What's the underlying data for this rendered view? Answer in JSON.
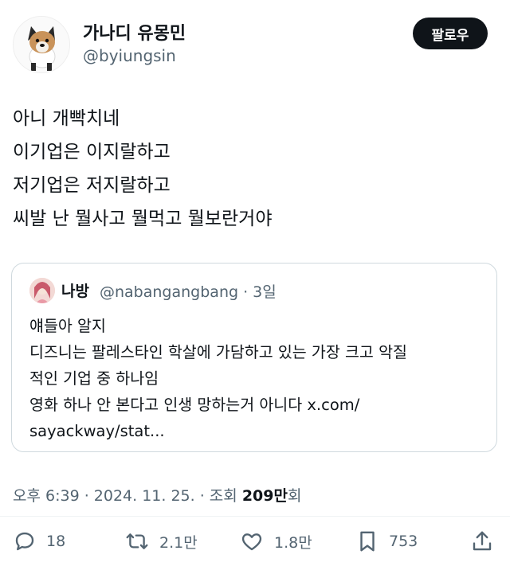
{
  "author": {
    "display_name": "가나디 유몽민",
    "handle": "@byiungsin",
    "follow_label": "팔로우"
  },
  "tweet": {
    "lines": [
      "아니 개빡치네",
      "이기업은 이지랄하고",
      "저기업은 저지랄하고",
      "씨발 난 뭘사고 뭘먹고 뭘보란거야"
    ]
  },
  "quote": {
    "name": "나방",
    "handle": "@nabangangbang",
    "time": "3일",
    "meta": "@nabangangbang · 3일",
    "lines": [
      "얘들아 알지",
      "디즈니는 팔레스타인 학살에 가담하고 있는 가장 크고 악질",
      "적인 기업 중 하나임",
      "영화 하나 안 본다고 인생 망하는거 아니다 x.com/",
      "sayackway/stat..."
    ]
  },
  "meta": {
    "prefix": "오후 6:39 · 2024. 11. 25. · 조회 ",
    "views": "209만",
    "suffix": "회"
  },
  "actions": {
    "replies": "18",
    "retweets": "2.1만",
    "likes": "1.8만",
    "bookmarks": "753"
  },
  "icons": [
    "reply-icon",
    "retweet-icon",
    "like-icon",
    "bookmark-icon",
    "share-icon"
  ],
  "colors": {
    "text": "#0f1419",
    "secondary": "#536471",
    "border": "#cfd9de"
  }
}
